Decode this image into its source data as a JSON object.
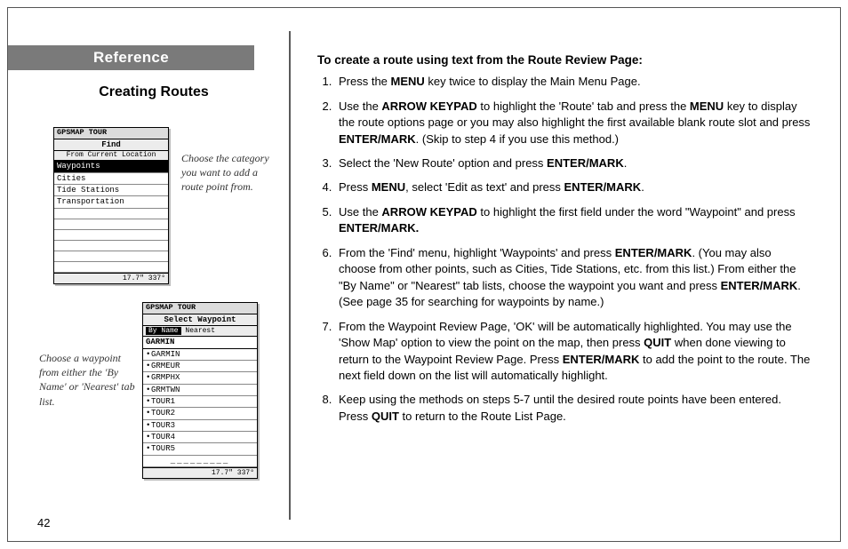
{
  "left": {
    "reference": "Reference",
    "subheading": "Creating Routes",
    "caption1": "Choose the category you want to add a route point from.",
    "caption2": "Choose a waypoint from either the 'By Name' or 'Nearest' tab list.",
    "page_number": "42"
  },
  "device1": {
    "title": "GPSMAP TOUR",
    "header": "Find",
    "sub": "From Current Location",
    "rows": [
      "Waypoints",
      "Cities",
      "Tide Stations",
      "Transportation"
    ],
    "footer": "17.7\"   337°"
  },
  "device2": {
    "title": "GPSMAP TOUR",
    "header": "Select Waypoint",
    "tab1": "By Name",
    "tab2": "Nearest",
    "filter": "GARMIN",
    "rows": [
      "GARMIN",
      "GRMEUR",
      "GRMPHX",
      "GRMTWN",
      "TOUR1",
      "TOUR2",
      "TOUR3",
      "TOUR4",
      "TOUR5"
    ],
    "footer": "17.7\"   337°"
  },
  "right": {
    "heading": "To create a route using text from the Route Review Page:",
    "step1_a": "Press the ",
    "step1_b": "MENU",
    "step1_c": " key twice to display the Main Menu Page.",
    "step2_a": "Use the ",
    "step2_b": "ARROW KEYPAD",
    "step2_c": " to highlight the 'Route' tab and press the ",
    "step2_d": "MENU",
    "step2_e": " key to display the route options page or you may also highlight the first available blank route slot and press ",
    "step2_f": "ENTER/MARK",
    "step2_g": ". (Skip to step 4 if you use this method.)",
    "step3_a": "Select the 'New Route' option and press ",
    "step3_b": "ENTER/MARK",
    "step3_c": ".",
    "step4_a": "Press ",
    "step4_b": "MENU",
    "step4_c": ", select 'Edit as text' and press ",
    "step4_d": "ENTER/MARK",
    "step4_e": ".",
    "step5_a": "Use the ",
    "step5_b": "ARROW KEYPAD",
    "step5_c": " to highlight the first field under the word \"Waypoint\" and press ",
    "step5_d": "ENTER/MARK.",
    "step6_a": "From the 'Find' menu, highlight 'Waypoints' and press ",
    "step6_b": "ENTER/MARK",
    "step6_c": ". (You may also choose from other points, such as Cities, Tide Stations, etc. from this list.) From either the \"By Name\" or \"Nearest\" tab lists, choose the waypoint you want and press ",
    "step6_d": "ENTER/MARK",
    "step6_e": ". (See page 35 for searching for waypoints by name.)",
    "step7_a": "From the Waypoint Review Page, 'OK' will be automatically highlighted. You may use the 'Show Map' option to view the point on the map, then press ",
    "step7_b": "QUIT",
    "step7_c": " when done viewing to return to the Waypoint Review Page. Press ",
    "step7_d": "ENTER/MARK",
    "step7_e": " to add the point to the route. The next field down on the list will automatically highlight.",
    "step8_a": "Keep using the methods on steps 5-7 until the desired route points have been entered. Press ",
    "step8_b": "QUIT",
    "step8_c": " to return to the Route List Page."
  }
}
